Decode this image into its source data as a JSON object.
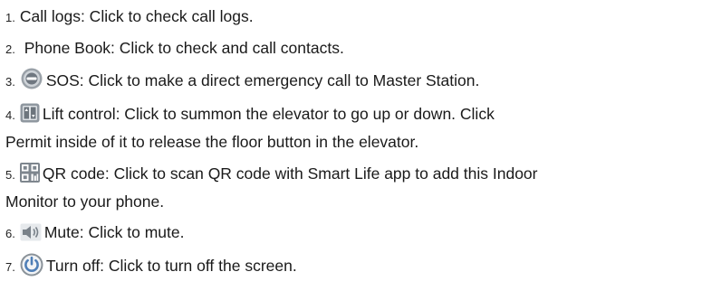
{
  "items": [
    {
      "num": "1.",
      "text": "Call logs: Click to   check call logs."
    },
    {
      "num": "2.",
      "text": " Phone Book: Click to check and call  contacts."
    },
    {
      "num": "3.",
      "icon": "sos-icon",
      "text": "SOS: Click to make a direct emergency call to Master  Station."
    },
    {
      "num": "4.",
      "icon": "lift-icon",
      "text": "Lift control: Click to summon the elevator to go up or down. Click",
      "cont": "Permit inside of it to release the floor button in the elevator."
    },
    {
      "num": "5.",
      "icon": "qr-code-icon",
      "text": "QR code: Click to scan QR code with Smart Life app to add this Indoor",
      "cont": "Monitor to your phone."
    },
    {
      "num": "6.",
      "icon": "speaker-mute-icon",
      "text": "Mute: Click to mute."
    },
    {
      "num": "7.",
      "icon": "power-icon",
      "text": "Turn off: Click to turn off the  screen."
    }
  ]
}
